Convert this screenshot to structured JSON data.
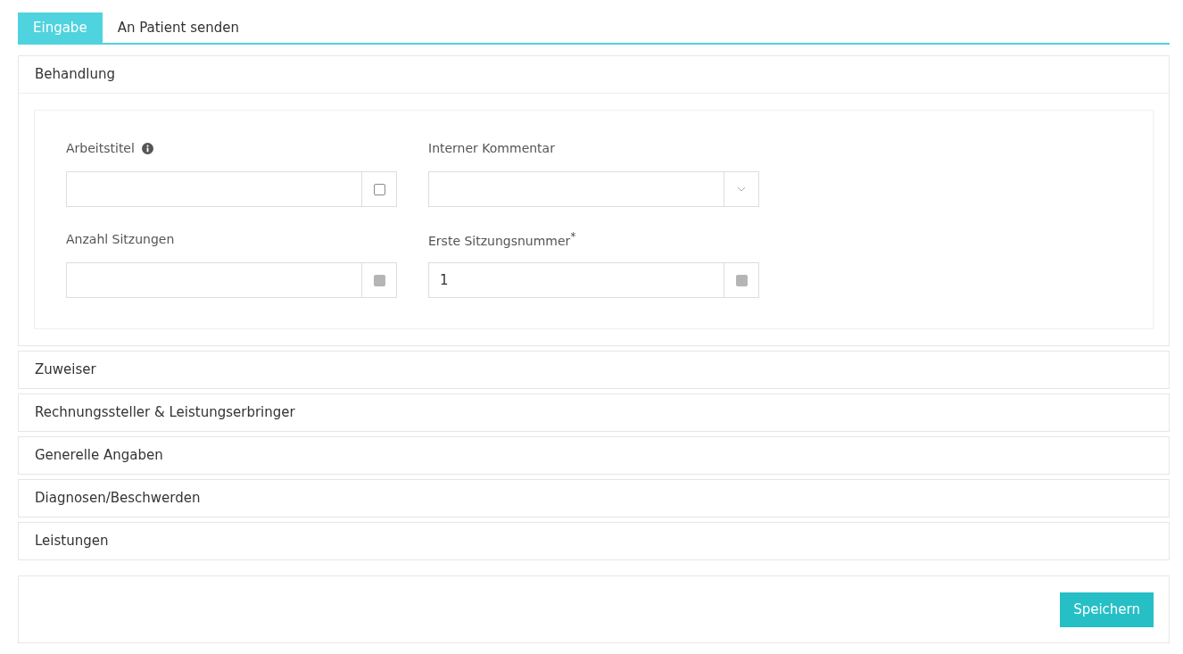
{
  "tabs": [
    {
      "label": "Eingabe",
      "selected": true
    },
    {
      "label": "An Patient senden",
      "selected": false
    }
  ],
  "sections": [
    {
      "title": "Behandlung",
      "expanded": true,
      "fields": [
        {
          "label": "Arbeitstitel",
          "info": true,
          "kind": "checkbox",
          "checked": false
        },
        {
          "label": "Interner Kommentar",
          "kind": "dropdown"
        },
        {
          "label": "Anzahl Sitzungen",
          "kind": "square"
        },
        {
          "label": "Erste Sitzungsnummer$^{*}$",
          "value": "1",
          "kind": "square"
        }
      ]
    },
    {
      "title": "Zuweiser",
      "expanded": false
    },
    {
      "title": "Rechnungssteller & Leistungserbringer",
      "expanded": false
    },
    {
      "title": "Generelle Angaben",
      "expanded": false
    },
    {
      "title": "Diagnosen/Beschwerden",
      "expanded": false
    },
    {
      "title": "Leistungen",
      "expanded": false
    }
  ],
  "footer": {
    "button": "Speichern"
  }
}
